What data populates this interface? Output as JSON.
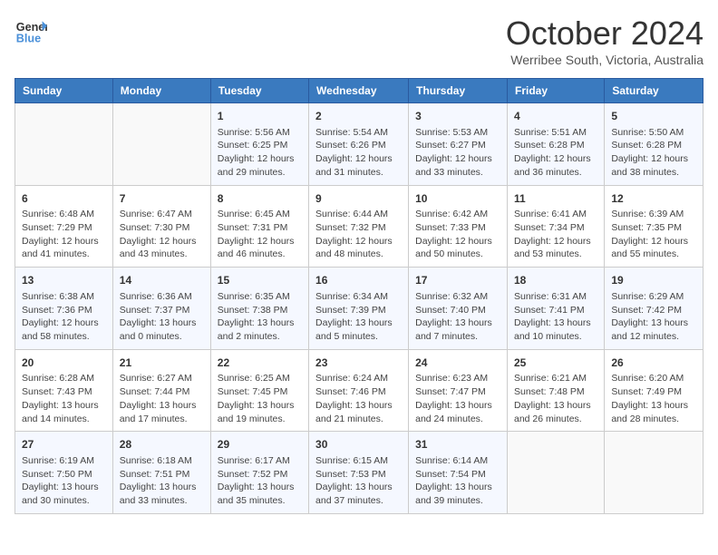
{
  "header": {
    "logo_line1": "General",
    "logo_line2": "Blue",
    "month": "October 2024",
    "location": "Werribee South, Victoria, Australia"
  },
  "weekdays": [
    "Sunday",
    "Monday",
    "Tuesday",
    "Wednesday",
    "Thursday",
    "Friday",
    "Saturday"
  ],
  "weeks": [
    [
      {
        "day": "",
        "content": ""
      },
      {
        "day": "",
        "content": ""
      },
      {
        "day": "1",
        "content": "Sunrise: 5:56 AM\nSunset: 6:25 PM\nDaylight: 12 hours and 29 minutes."
      },
      {
        "day": "2",
        "content": "Sunrise: 5:54 AM\nSunset: 6:26 PM\nDaylight: 12 hours and 31 minutes."
      },
      {
        "day": "3",
        "content": "Sunrise: 5:53 AM\nSunset: 6:27 PM\nDaylight: 12 hours and 33 minutes."
      },
      {
        "day": "4",
        "content": "Sunrise: 5:51 AM\nSunset: 6:28 PM\nDaylight: 12 hours and 36 minutes."
      },
      {
        "day": "5",
        "content": "Sunrise: 5:50 AM\nSunset: 6:28 PM\nDaylight: 12 hours and 38 minutes."
      }
    ],
    [
      {
        "day": "6",
        "content": "Sunrise: 6:48 AM\nSunset: 7:29 PM\nDaylight: 12 hours and 41 minutes."
      },
      {
        "day": "7",
        "content": "Sunrise: 6:47 AM\nSunset: 7:30 PM\nDaylight: 12 hours and 43 minutes."
      },
      {
        "day": "8",
        "content": "Sunrise: 6:45 AM\nSunset: 7:31 PM\nDaylight: 12 hours and 46 minutes."
      },
      {
        "day": "9",
        "content": "Sunrise: 6:44 AM\nSunset: 7:32 PM\nDaylight: 12 hours and 48 minutes."
      },
      {
        "day": "10",
        "content": "Sunrise: 6:42 AM\nSunset: 7:33 PM\nDaylight: 12 hours and 50 minutes."
      },
      {
        "day": "11",
        "content": "Sunrise: 6:41 AM\nSunset: 7:34 PM\nDaylight: 12 hours and 53 minutes."
      },
      {
        "day": "12",
        "content": "Sunrise: 6:39 AM\nSunset: 7:35 PM\nDaylight: 12 hours and 55 minutes."
      }
    ],
    [
      {
        "day": "13",
        "content": "Sunrise: 6:38 AM\nSunset: 7:36 PM\nDaylight: 12 hours and 58 minutes."
      },
      {
        "day": "14",
        "content": "Sunrise: 6:36 AM\nSunset: 7:37 PM\nDaylight: 13 hours and 0 minutes."
      },
      {
        "day": "15",
        "content": "Sunrise: 6:35 AM\nSunset: 7:38 PM\nDaylight: 13 hours and 2 minutes."
      },
      {
        "day": "16",
        "content": "Sunrise: 6:34 AM\nSunset: 7:39 PM\nDaylight: 13 hours and 5 minutes."
      },
      {
        "day": "17",
        "content": "Sunrise: 6:32 AM\nSunset: 7:40 PM\nDaylight: 13 hours and 7 minutes."
      },
      {
        "day": "18",
        "content": "Sunrise: 6:31 AM\nSunset: 7:41 PM\nDaylight: 13 hours and 10 minutes."
      },
      {
        "day": "19",
        "content": "Sunrise: 6:29 AM\nSunset: 7:42 PM\nDaylight: 13 hours and 12 minutes."
      }
    ],
    [
      {
        "day": "20",
        "content": "Sunrise: 6:28 AM\nSunset: 7:43 PM\nDaylight: 13 hours and 14 minutes."
      },
      {
        "day": "21",
        "content": "Sunrise: 6:27 AM\nSunset: 7:44 PM\nDaylight: 13 hours and 17 minutes."
      },
      {
        "day": "22",
        "content": "Sunrise: 6:25 AM\nSunset: 7:45 PM\nDaylight: 13 hours and 19 minutes."
      },
      {
        "day": "23",
        "content": "Sunrise: 6:24 AM\nSunset: 7:46 PM\nDaylight: 13 hours and 21 minutes."
      },
      {
        "day": "24",
        "content": "Sunrise: 6:23 AM\nSunset: 7:47 PM\nDaylight: 13 hours and 24 minutes."
      },
      {
        "day": "25",
        "content": "Sunrise: 6:21 AM\nSunset: 7:48 PM\nDaylight: 13 hours and 26 minutes."
      },
      {
        "day": "26",
        "content": "Sunrise: 6:20 AM\nSunset: 7:49 PM\nDaylight: 13 hours and 28 minutes."
      }
    ],
    [
      {
        "day": "27",
        "content": "Sunrise: 6:19 AM\nSunset: 7:50 PM\nDaylight: 13 hours and 30 minutes."
      },
      {
        "day": "28",
        "content": "Sunrise: 6:18 AM\nSunset: 7:51 PM\nDaylight: 13 hours and 33 minutes."
      },
      {
        "day": "29",
        "content": "Sunrise: 6:17 AM\nSunset: 7:52 PM\nDaylight: 13 hours and 35 minutes."
      },
      {
        "day": "30",
        "content": "Sunrise: 6:15 AM\nSunset: 7:53 PM\nDaylight: 13 hours and 37 minutes."
      },
      {
        "day": "31",
        "content": "Sunrise: 6:14 AM\nSunset: 7:54 PM\nDaylight: 13 hours and 39 minutes."
      },
      {
        "day": "",
        "content": ""
      },
      {
        "day": "",
        "content": ""
      }
    ]
  ]
}
